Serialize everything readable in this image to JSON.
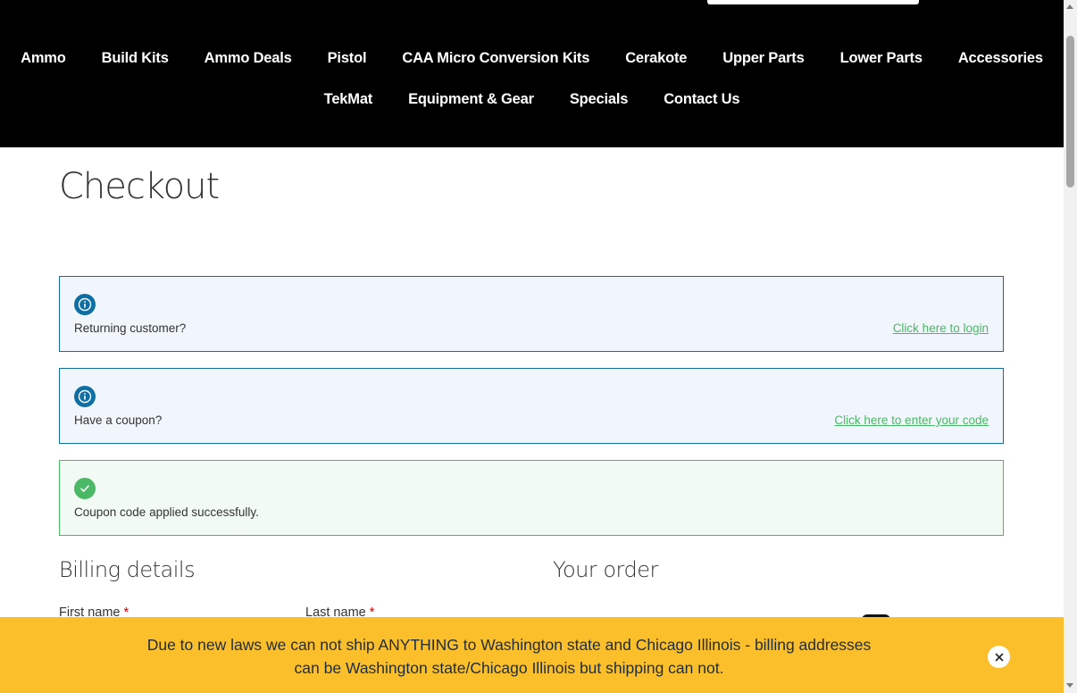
{
  "nav": {
    "row1": [
      "Ammo",
      "Build Kits",
      "Ammo Deals",
      "Pistol",
      "CAA Micro Conversion Kits",
      "Cerakote",
      "Upper Parts",
      "Lower Parts",
      "Accessories"
    ],
    "row2": [
      "TekMat",
      "Equipment & Gear",
      "Specials",
      "Contact Us"
    ]
  },
  "page": {
    "title": "Checkout"
  },
  "notices": {
    "login": {
      "text": "Returning customer?",
      "link": "Click here to login",
      "icon": "info-icon"
    },
    "coupon": {
      "text": "Have a coupon?",
      "link": "Click here to enter your code",
      "icon": "info-icon"
    },
    "success": {
      "text": "Coupon code applied successfully.",
      "icon": "check-icon"
    }
  },
  "billing": {
    "heading": "Billing details",
    "first_name_label": "First name",
    "last_name_label": "Last name",
    "required_mark": "*"
  },
  "order": {
    "heading": "Your order"
  },
  "store_notice": {
    "message": "Due to new laws we can not ship ANYTHING to Washington state and Chicago Illinois - billing addresses can be Washington state/Chicago Illinois but shipping can not.",
    "dismiss_icon": "close-icon"
  },
  "colors": {
    "header_bg": "#000000",
    "info_border": "#0f6fa3",
    "info_bg": "#f0f6fb",
    "success_border": "#4ab866",
    "success_bg": "#f1fbf3",
    "link": "#4ab866",
    "banner_bg": "#fbbf2c",
    "required": "#cc0000"
  }
}
